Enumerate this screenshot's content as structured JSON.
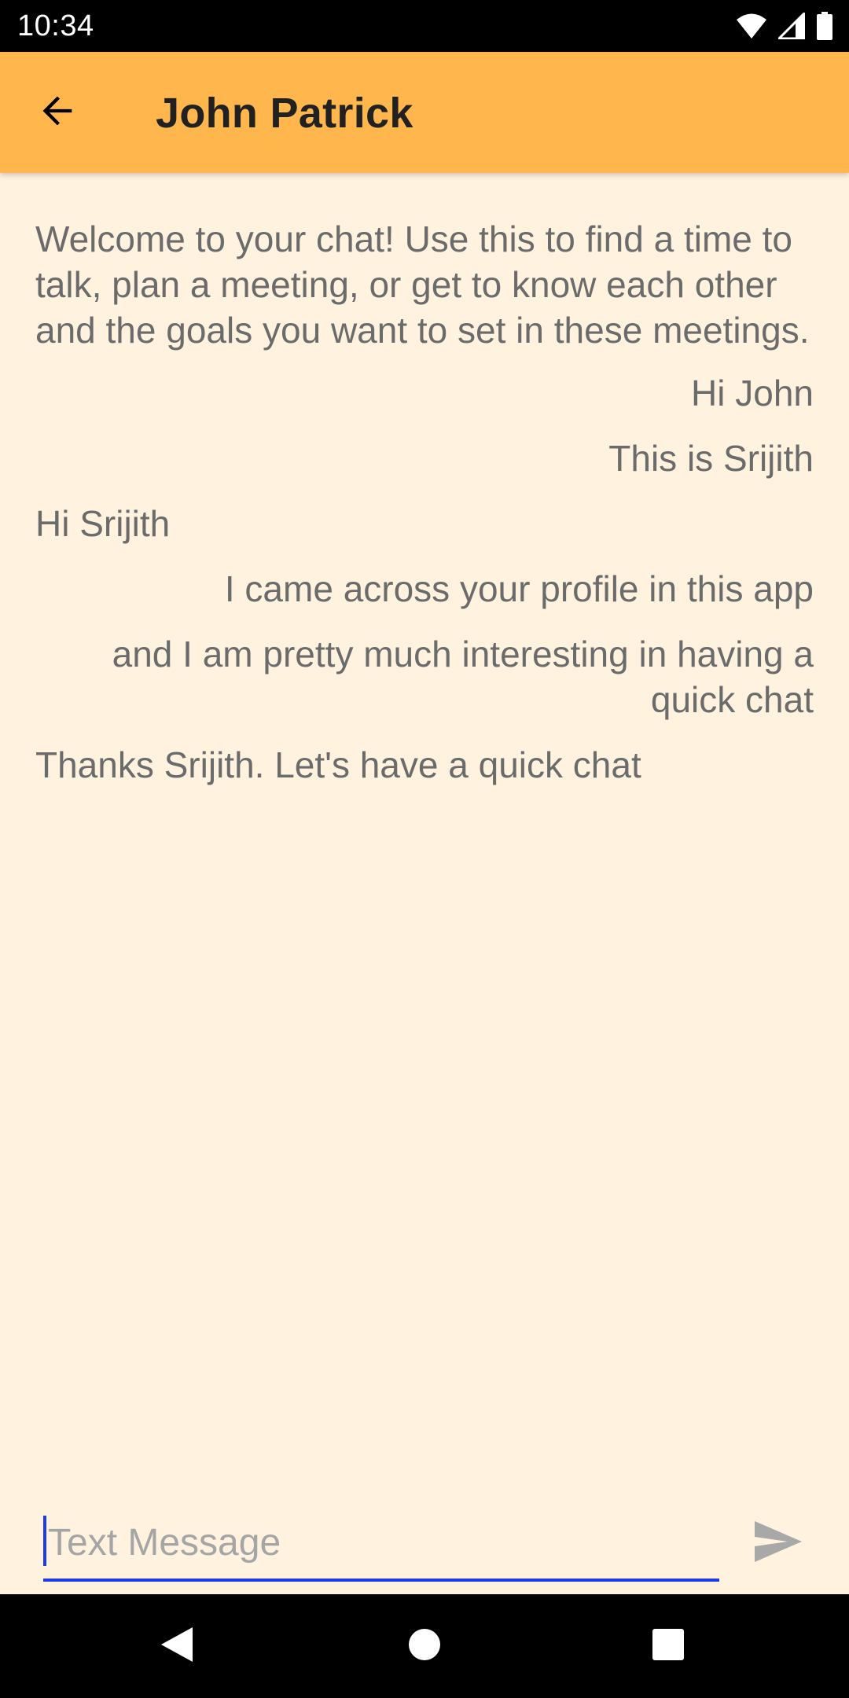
{
  "status_bar": {
    "time": "10:34",
    "icons": [
      "wifi-icon",
      "signal-icon",
      "battery-icon"
    ]
  },
  "app_bar": {
    "title": "John Patrick",
    "back_icon": "arrow-back-icon",
    "background_color": "#FFB74D"
  },
  "chat": {
    "welcome_text": "Welcome to your chat! Use this to find a time to talk, plan a meeting, or get to know each other and the goals you want to set in these meetings.",
    "messages": [
      {
        "side": "right",
        "text": "Hi John"
      },
      {
        "side": "right",
        "text": "This is Srijith"
      },
      {
        "side": "left",
        "text": "Hi Srijith"
      },
      {
        "side": "right",
        "text": "I came across your profile in this app"
      },
      {
        "side": "right",
        "text": "and I am pretty much interesting in having a quick chat"
      },
      {
        "side": "left",
        "text": "Thanks Srijith. Let's have a quick chat"
      }
    ]
  },
  "composer": {
    "placeholder": "Text Message",
    "value": "",
    "send_icon": "send-icon",
    "accent_color": "#1E3CE6"
  },
  "nav_bar": {
    "icons": [
      "nav-back-icon",
      "nav-home-icon",
      "nav-recents-icon"
    ]
  }
}
